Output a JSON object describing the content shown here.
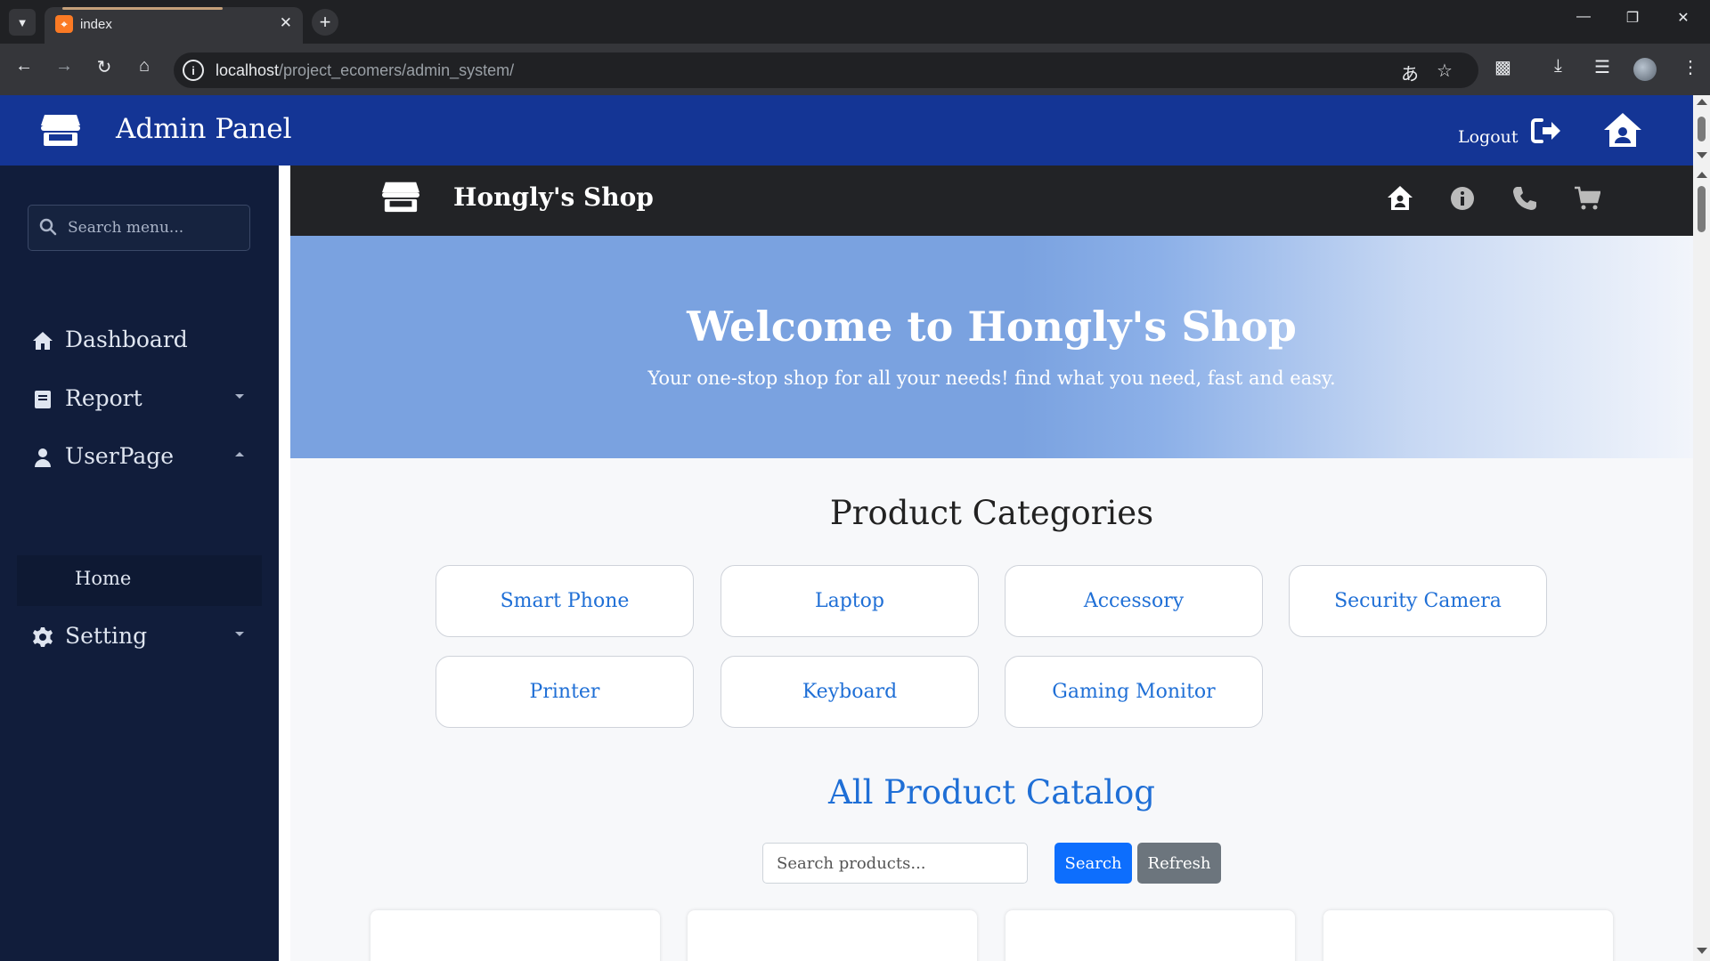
{
  "browser": {
    "tab_title": "index",
    "tab_favicon": "xampp-favicon-icon",
    "url_host": "localhost",
    "url_path": "/project_ecomers/admin_system/"
  },
  "topbar": {
    "title": "Admin Panel",
    "logout_label": "Logout",
    "color": "#143595"
  },
  "sidebar": {
    "search_placeholder": "Search menu...",
    "items": [
      {
        "label": "Dashboard",
        "icon": "home-icon"
      },
      {
        "label": "Report",
        "icon": "report-icon",
        "caret": "down"
      },
      {
        "label": "UserPage",
        "icon": "user-icon",
        "caret": "up"
      },
      {
        "label": "Setting",
        "icon": "gear-icon",
        "caret": "down"
      }
    ],
    "submenu": {
      "label": "Home"
    },
    "color": "#111d3b"
  },
  "shop": {
    "title": "Hongly's Shop",
    "nav_icons": [
      "home-icon",
      "info-icon",
      "phone-icon",
      "cart-icon"
    ]
  },
  "hero": {
    "heading": "Welcome to Hongly's Shop",
    "subtitle": "Your one-stop shop for all your needs! find what you need, fast and easy."
  },
  "categories": {
    "title": "Product Categories",
    "items": [
      "Smart Phone",
      "Laptop",
      "Accessory",
      "Security Camera",
      "Printer",
      "Keyboard",
      "Gaming Monitor"
    ]
  },
  "catalog": {
    "title": "All Product Catalog",
    "search_placeholder": "Search products...",
    "search_label": "Search",
    "refresh_label": "Refresh"
  }
}
